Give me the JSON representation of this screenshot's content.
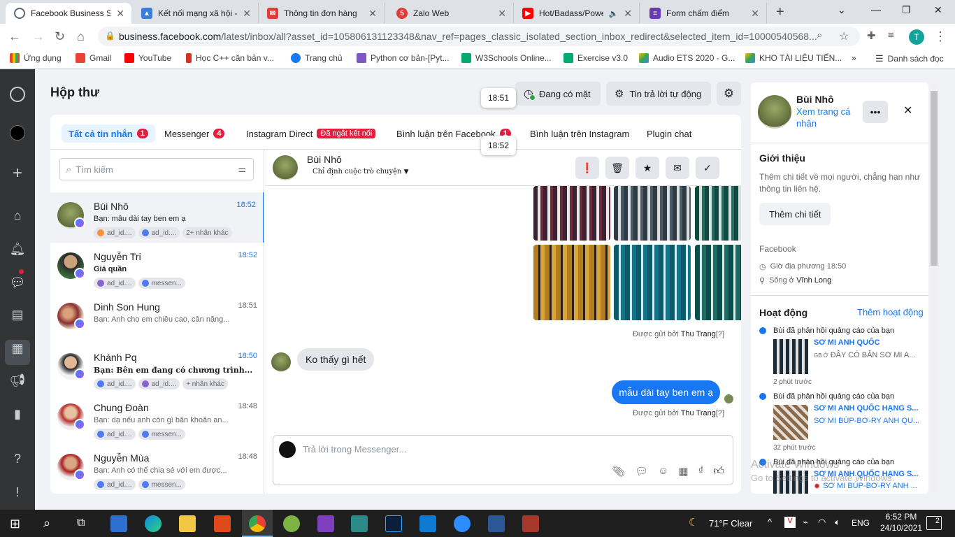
{
  "browser": {
    "tabs": [
      {
        "title": "Facebook Business Su",
        "active": true
      },
      {
        "title": "Kết nối mạng xã hội -"
      },
      {
        "title": "Thông tin đơn hàng"
      },
      {
        "title": "Zalo Web"
      },
      {
        "title": "Hot/Badass/Powe"
      },
      {
        "title": "Form chấm điểm"
      }
    ],
    "url_host": "business.facebook.com",
    "url_path": "/latest/inbox/all?asset_id=105806131123348&nav_ref=pages_classic_isolated_section_inbox_redirect&selected_item_id=10000540568...",
    "profile_initial": "T",
    "bookmarks": [
      "Ứng dụng",
      "Gmail",
      "YouTube",
      "Học C++ căn bản v...",
      "Trang chủ",
      "Python cơ bản-[Pyt...",
      "W3Schools Online...",
      "Exercise v3.0",
      "Audio ETS 2020 - G...",
      "KHO TÀI LIỆU TIẾN..."
    ],
    "reading_list": "Danh sách đọc",
    "more": "»"
  },
  "header": {
    "title": "Hộp thư",
    "presence_label": "Đang có mặt",
    "auto_reply_label": "Tin trả lời tự động",
    "tooltip1": "18:51",
    "tooltip2": "18:52"
  },
  "filters": {
    "all": {
      "label": "Tất cả tin nhắn",
      "count": "1"
    },
    "messenger": {
      "label": "Messenger",
      "count": "4"
    },
    "instagram": {
      "label": "Instagram Direct",
      "badge": "Đã ngắt kết nối"
    },
    "fb_comments": {
      "label": "Bình luận trên Facebook",
      "count": "1"
    },
    "ig_comments": {
      "label": "Bình luận trên Instagram"
    },
    "plugin": {
      "label": "Plugin chat"
    }
  },
  "search": {
    "placeholder": "Tìm kiếm"
  },
  "conversations": [
    {
      "name": "Bùi Nhô",
      "time": "18:52",
      "preview": "Bạn: mẫu dài tay ben em ạ",
      "chips": [
        "ad_id....",
        "ad_id....",
        "2+ nhãn khác"
      ]
    },
    {
      "name": "Nguyễn Tri",
      "time": "18:52",
      "preview": "Giá quần",
      "chips": [
        "ad_id....",
        "messen..."
      ]
    },
    {
      "name": "Dinh Son Hung",
      "time": "18:51",
      "preview": "Bạn: Anh cho em chiều cao, cân nặng...",
      "chips": []
    },
    {
      "name": "Khánh Pq",
      "time": "18:50",
      "preview": "Bạn: Bên em đang có chương trình...",
      "chips": [
        "ad_id....",
        "ad_id....",
        "+ nhãn khác"
      ]
    },
    {
      "name": "Chung Đoàn",
      "time": "18:48",
      "preview": "Bạn: dạ nếu anh còn gì băn khoăn an...",
      "chips": [
        "ad_id....",
        "messen..."
      ]
    },
    {
      "name": "Nguyễn Mùa",
      "time": "18:48",
      "preview": "Bạn: Anh có thể chia sẻ với em được...",
      "chips": [
        "ad_id....",
        "messen..."
      ]
    }
  ],
  "thread": {
    "name": "Bùi Nhô",
    "assign": "Chỉ định cuộc trò chuyện",
    "sent_by_prefix": "Được gửi bởi",
    "sent_by_name": "Thu Trang",
    "sent_by_suffix": "[?]",
    "incoming": "Ko thấy gì hết",
    "outgoing": "mẫu dài tay ben em ạ",
    "composer_placeholder": "Trả lời trong Messenger..."
  },
  "profile": {
    "name": "Bùi Nhô",
    "view_profile": "Xem trang cá nhân",
    "intro_title": "Giới thiệu",
    "intro_text": "Thêm chi tiết về mọi người, chẳng hạn như thông tin liên hệ.",
    "add_details": "Thêm chi tiết",
    "facebook_label": "Facebook",
    "local_time": "Giờ địa phương 18:50",
    "lives_in_prefix": "Sống ở",
    "lives_in": "Vĩnh Long",
    "activity_title": "Hoạt động",
    "add_activity": "Thêm hoạt động",
    "activities": [
      {
        "text": "Bùi đã phản hồi quảng cáo của bạn",
        "ad_title": "SƠ MI ANH QUỐC",
        "ad_sub": "ĐÂY CÓ BẢN SƠ MI A...",
        "ad_prefix": "GB Ở",
        "time": "2 phút trước"
      },
      {
        "text": "Bùi đã phản hồi quảng cáo của bạn",
        "ad_title": "SƠ MI ANH QUỐC HẠNG S...",
        "ad_sub": "SƠ MI BÚP-BƠ-RY ANH QU...",
        "time": "32 phút trước"
      },
      {
        "text": "Bùi đã phản hồi quảng cáo của bạn",
        "ad_title": "SƠ MI ANH QUỐC HẠNG S...",
        "ad_sub": "SƠ MI BÚP-BƠ-RY ANH ..."
      }
    ]
  },
  "watermark": {
    "line1": "Activate Windows",
    "line2": "Go to Settings to activate Windows."
  },
  "taskbar": {
    "weather": "71°F  Clear",
    "lang": "ENG",
    "time": "6:52 PM",
    "date": "24/10/2021",
    "notif": "2"
  },
  "colors": {
    "accent": "#1877f2",
    "badge": "#e41e3f",
    "online": "#31a24c"
  }
}
